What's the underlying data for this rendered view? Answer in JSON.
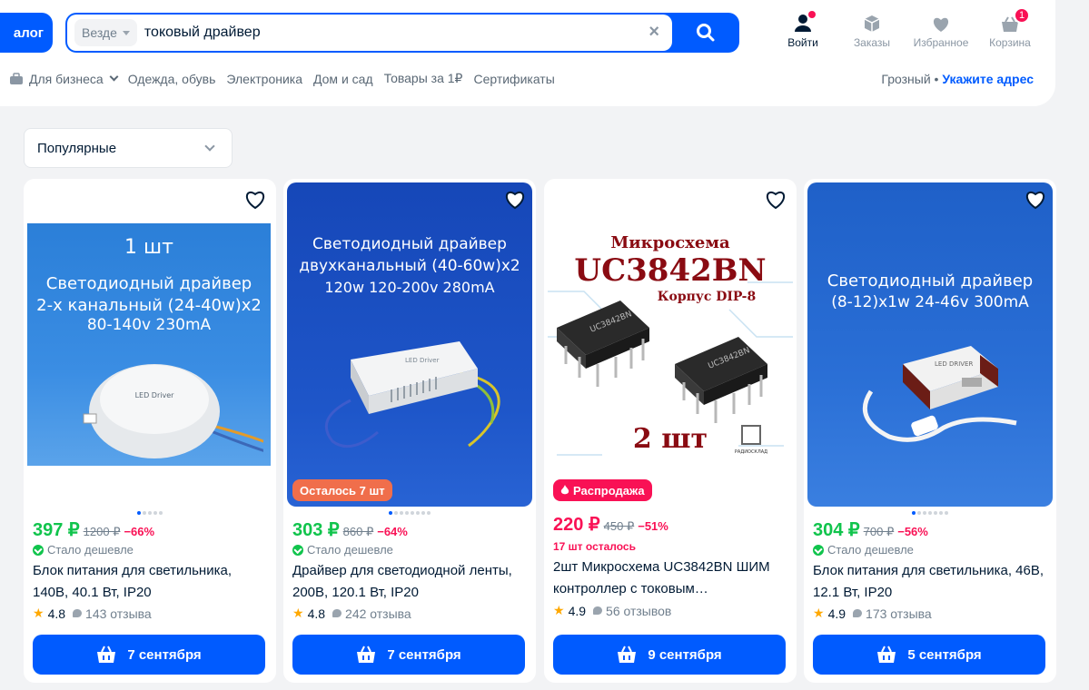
{
  "header": {
    "catalog_label": "алог",
    "search": {
      "scope": "Везде",
      "value": "токовый драйвер"
    },
    "icons": [
      {
        "label": "Войти",
        "icon": "user-icon"
      },
      {
        "label": "Заказы",
        "icon": "box-icon"
      },
      {
        "label": "Избранное",
        "icon": "heart-icon"
      },
      {
        "label": "Корзина",
        "icon": "cart-icon",
        "count": "1"
      }
    ],
    "nav": [
      "Для бизнеса",
      "Одежда, обувь",
      "Электроника",
      "Дом и сад",
      "Товары за 1₽",
      "Сертификаты"
    ],
    "city": "Грозный",
    "address_link": "Укажите адрес",
    "separator": "•"
  },
  "sort": {
    "selected": "Популярные"
  },
  "products": [
    {
      "price": "397 ₽",
      "old_price": "1200 ₽",
      "discount": "−66%",
      "sub": "Стало дешевле",
      "title": "Блок питания для светильника, 140В, 40.1 Вт, IP20",
      "rating": "4.8",
      "reviews": "143 отзыва",
      "delivery": "7 сентября",
      "image_text": [
        "1 шт",
        "Светодиодный драйвер",
        "2-х канальный (24-40w)x2",
        "80-140v        230mA"
      ],
      "image_label": "LED Driver"
    },
    {
      "price": "303 ₽",
      "old_price": "860 ₽",
      "discount": "−64%",
      "sub": "Стало дешевле",
      "title": "Драйвер для светодиодной ленты, 200В, 120.1 Вт, IP20",
      "rating": "4.8",
      "reviews": "242 отзыва",
      "delivery": "7 сентября",
      "badge": "Осталось 7 шт",
      "image_text": [
        "Светодиодный драйвер",
        "двухканальный (40-60w)x2",
        "120w    120-200v    280mA"
      ],
      "image_label": "LED Driver"
    },
    {
      "price": "220 ₽",
      "old_price": "450 ₽",
      "discount": "−51%",
      "sub": "17 шт осталось",
      "title": "2шт Микросхема UC3842BN ШИМ контроллер с токовым…",
      "rating": "4.9",
      "reviews": "56 отзывов",
      "delivery": "9 сентября",
      "badge": "Распродажа",
      "image_text": [
        "Микросхема",
        "UC3842BN",
        "Корпус DIP-8",
        "2 шт"
      ],
      "image_label": "РАДИОСКЛАД",
      "chip_marking": "UC3842BN"
    },
    {
      "price": "304 ₽",
      "old_price": "700 ₽",
      "discount": "−56%",
      "sub": "Стало дешевле",
      "title": "Блок питания для светильника, 46В, 12.1 Вт, IP20",
      "rating": "4.9",
      "reviews": "173 отзыва",
      "delivery": "5 сентября",
      "image_text": [
        "Светодиодный драйвер",
        "(8-12)x1w   24-46v   300mA"
      ],
      "image_label": "LED DRIVER"
    }
  ],
  "colors": {
    "accent": "#005bff",
    "green": "#10c44c",
    "pink": "#f91155",
    "badge_orange": "#f06e4b"
  }
}
